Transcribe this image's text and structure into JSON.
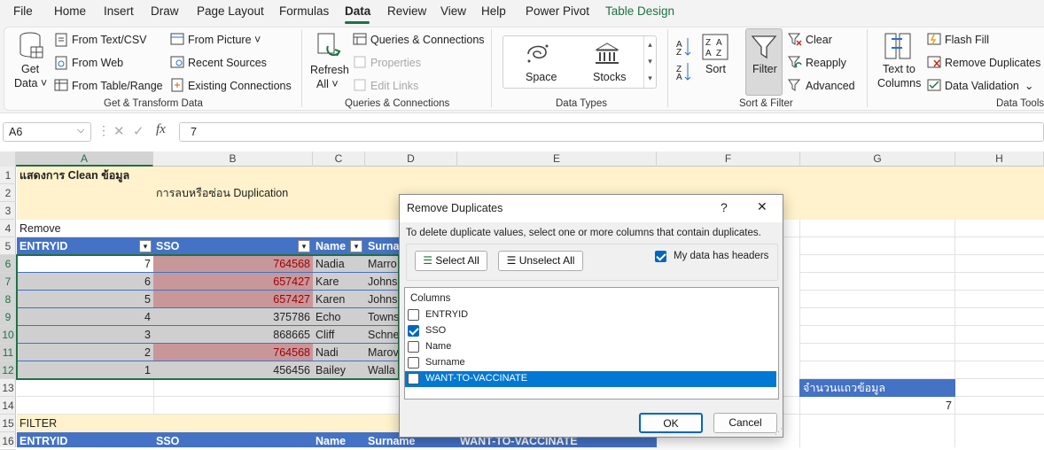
{
  "menu": [
    "File",
    "Home",
    "Insert",
    "Draw",
    "Page Layout",
    "Formulas",
    "Data",
    "Review",
    "View",
    "Help",
    "Power Pivot",
    "Table Design"
  ],
  "ribbon": {
    "get_data_1": "Get",
    "get_data_2": "Data ˅",
    "from_text_csv": "From Text/CSV",
    "from_web": "From Web",
    "from_table_range": "From Table/Range",
    "from_picture": "From Picture ˅",
    "recent_sources": "Recent Sources",
    "existing_connections": "Existing Connections",
    "group_get_transform": "Get & Transform Data",
    "refresh_all_1": "Refresh",
    "refresh_all_2": "All ˅",
    "queries_connections": "Queries & Connections",
    "properties": "Properties",
    "edit_links": "Edit Links",
    "group_queries": "Queries & Connections",
    "space": "Space",
    "stocks": "Stocks",
    "group_data_types": "Data Types",
    "sort": "Sort",
    "filter": "Filter",
    "clear": "Clear",
    "reapply": "Reapply",
    "advanced": "Advanced",
    "group_sort_filter": "Sort & Filter",
    "text_to_columns_1": "Text to",
    "text_to_columns_2": "Columns",
    "flash_fill": "Flash Fill",
    "remove_duplicates": "Remove Duplicates",
    "data_validation": "Data Validation",
    "group_data_tools": "Data Tools"
  },
  "formula_bar": {
    "name_box": "A6",
    "formula": "7"
  },
  "columns": [
    "A",
    "B",
    "C",
    "D",
    "E",
    "F",
    "G",
    "H"
  ],
  "rows": [
    "1",
    "2",
    "3",
    "4",
    "5",
    "6",
    "7",
    "8",
    "9",
    "10",
    "11",
    "12",
    "13",
    "14",
    "15",
    "16"
  ],
  "sheet": {
    "title": "แสดงการ Clean ข้อมูล",
    "subtitle": "การลบหรือซ่อน Duplication",
    "remove_label": "Remove",
    "headers": [
      "ENTRYID",
      "SSO",
      "Name",
      "Surna"
    ],
    "table_rows": [
      {
        "id": "7",
        "sso": "764568",
        "name": "Nadia",
        "surname": "Marro"
      },
      {
        "id": "6",
        "sso": "657427",
        "name": "Kare",
        "surname": "Johns"
      },
      {
        "id": "5",
        "sso": "657427",
        "name": "Karen",
        "surname": "Johns"
      },
      {
        "id": "4",
        "sso": "375786",
        "name": "Echo",
        "surname": "Towns"
      },
      {
        "id": "3",
        "sso": "868665",
        "name": "Cliff",
        "surname": "Schne"
      },
      {
        "id": "2",
        "sso": "764568",
        "name": "Nadi",
        "surname": "Marov"
      },
      {
        "id": "1",
        "sso": "456456",
        "name": "Bailey",
        "surname": "Walla"
      }
    ],
    "count_label": "จำนวนแถวข้อมูล",
    "count_value": "7",
    "filter_label": "FILTER",
    "headers2": [
      "ENTRYID",
      "SSO",
      "Name",
      "Surname",
      "WANT-TO-VACCINATE"
    ]
  },
  "dialog": {
    "title": "Remove Duplicates",
    "help": "?",
    "close": "✕",
    "instruction": "To delete duplicate values, select one or more columns that contain duplicates.",
    "select_all": "Select All",
    "unselect_all": "Unselect All",
    "my_data_has_headers": "My data has headers",
    "columns_label": "Columns",
    "columns": [
      {
        "label": "ENTRYID",
        "checked": false
      },
      {
        "label": "SSO",
        "checked": true
      },
      {
        "label": "Name",
        "checked": false
      },
      {
        "label": "Surname",
        "checked": false
      },
      {
        "label": "WANT-TO-VACCINATE",
        "checked": false
      }
    ],
    "ok": "OK",
    "cancel": "Cancel"
  },
  "colors": {
    "accent_green": "#1e7145",
    "table_header": "#4472c4",
    "duplicate_fill": "#c8979a",
    "selection_gray": "#cfcfcf",
    "title_band": "#fff2cc",
    "dialog_highlight": "#0078d4"
  }
}
